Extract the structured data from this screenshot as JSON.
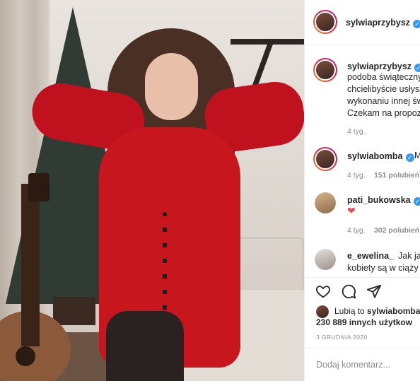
{
  "post": {
    "author": "sylwiaprzybysz",
    "author_verified": true
  },
  "caption": {
    "username": "sylwiaprzybysz",
    "lines": [
      "podoba świąteczny",
      "chcielibyście usłysz",
      "wykonaniu innej św",
      "Czekam na propoz"
    ],
    "time": "4 tyg."
  },
  "comments": [
    {
      "username": "sylwiabomba",
      "verified": true,
      "text": "M",
      "time": "4 tyg.",
      "likes": "151 polubień"
    },
    {
      "username": "pati_bukowska",
      "verified": true,
      "text": "❤",
      "time": "4 tyg.",
      "likes": "302 polubień"
    },
    {
      "username": "e_ewelina_",
      "verified": false,
      "text": "Jak ja k",
      "text2": "kobiety są w ciąży"
    }
  ],
  "actions": {
    "like_icon": "heart-outline-icon",
    "comment_icon": "comment-bubble-icon",
    "share_icon": "paper-plane-icon"
  },
  "likes": {
    "prefix": "Lubią to ",
    "user": "sylwiabomba",
    "count_line": "230 889 innych użytkow"
  },
  "date": "3 GRUDNIA 2020",
  "comment_box": {
    "placeholder": "Dodaj komentarz..."
  },
  "colors": {
    "verified": "#3897f0",
    "heart": "#ed4956",
    "dress": "#c8161f"
  }
}
